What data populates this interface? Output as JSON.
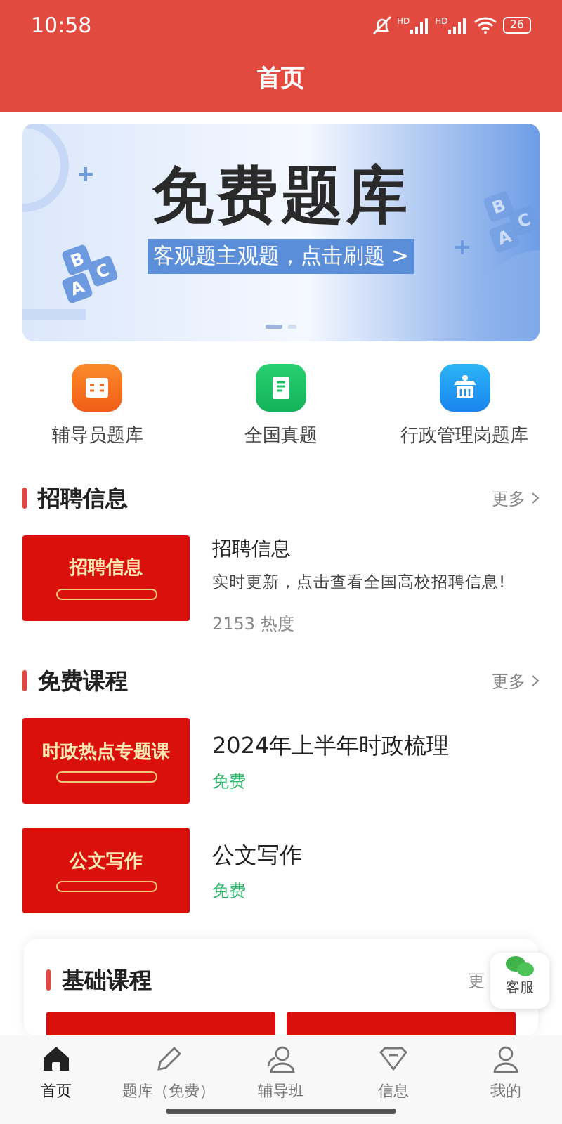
{
  "status_bar": {
    "time": "10:58",
    "signal_labels": [
      "HD",
      "HD"
    ],
    "battery": "26"
  },
  "header": {
    "title": "首页"
  },
  "banner": {
    "title": "免费题库",
    "subtitle": "客观题主观题，点击刷题 >",
    "left_blocks": [
      "B",
      "C",
      "A"
    ],
    "right_blocks": [
      "B",
      "C",
      "A"
    ],
    "pages": [
      {
        "selected": true
      },
      {
        "selected": false
      }
    ]
  },
  "quick_links": [
    {
      "label": "辅导员题库",
      "kind": "book"
    },
    {
      "label": "全国真题",
      "kind": "paper"
    },
    {
      "label": "行政管理岗题库",
      "kind": "building"
    }
  ],
  "sections": [
    {
      "title": "招聘信息",
      "more": "更多",
      "items": [
        {
          "thumb_title": "招聘信息",
          "title": "招聘信息",
          "desc": "实时更新，点击查看全国高校招聘信息!",
          "meta": "2153 热度",
          "kind": "news"
        }
      ]
    },
    {
      "title": "免费课程",
      "more": "更多",
      "items": [
        {
          "thumb_title": "时政热点专题课",
          "title": "2024年上半年时政梳理",
          "meta": "免费",
          "kind": "course"
        },
        {
          "thumb_title": "公文写作",
          "title": "公文写作",
          "meta": "免费",
          "kind": "course"
        }
      ]
    }
  ],
  "basic_courses": {
    "title": "基础课程",
    "more": "更"
  },
  "float_button": {
    "label": "客服"
  },
  "tab_bar": [
    {
      "label": "首页",
      "kind": "home",
      "selected": true
    },
    {
      "label": "题库（免费）",
      "kind": "pencil",
      "selected": false
    },
    {
      "label": "辅导班",
      "kind": "people",
      "selected": false
    },
    {
      "label": "信息",
      "kind": "diamond",
      "selected": false
    },
    {
      "label": "我的",
      "kind": "person",
      "selected": false
    }
  ]
}
